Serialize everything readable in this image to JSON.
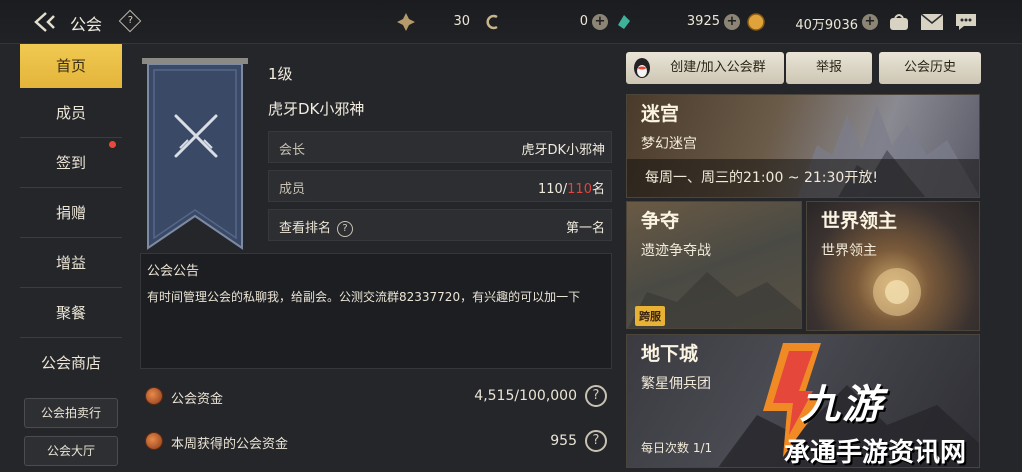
{
  "header": {
    "title": "公会",
    "help": "?",
    "resources": [
      {
        "value": "30"
      },
      {
        "value": "0"
      },
      {
        "value": "3925"
      },
      {
        "value": "40万9036"
      }
    ]
  },
  "sidebar": {
    "items": [
      {
        "label": "首页"
      },
      {
        "label": "成员"
      },
      {
        "label": "签到"
      },
      {
        "label": "捐赠"
      },
      {
        "label": "增益"
      },
      {
        "label": "聚餐"
      },
      {
        "label": "公会商店"
      }
    ],
    "bottom": [
      {
        "label": "公会拍卖行"
      },
      {
        "label": "公会大厅"
      }
    ]
  },
  "guild": {
    "level": "1级",
    "name": "虎牙DK小邪神",
    "leader_label": "会长",
    "leader_value": "虎牙DK小邪神",
    "members_label": "成员",
    "members_current": "110/",
    "members_max": "110",
    "members_unit": "名",
    "rank_label": "查看排名",
    "rank_value": "第一名"
  },
  "notice": {
    "title": "公会公告",
    "text": "有时间管理公会的私聊我，给副会。公测交流群82337720，有兴趣的可以加一下"
  },
  "funds": {
    "fund_label": "公会资金",
    "fund_value": "4,515/100,000",
    "weekly_label": "本周获得的公会资金",
    "weekly_value": "955"
  },
  "actions": {
    "join_group": "创建/加入公会群",
    "report": "举报",
    "history": "公会历史"
  },
  "panels": {
    "maze_title": "迷宫",
    "maze_sub": "梦幻迷宫",
    "maze_time": "每周一、周三的21:00 ~ 21:30开放!",
    "contest_title": "争夺",
    "contest_sub": "遗迹争夺战",
    "contest_tag": "跨服",
    "boss_title": "世界领主",
    "boss_sub": "世界领主",
    "dungeon_title": "地下城",
    "dungeon_sub": "繁星佣兵团",
    "dungeon_count": "每日次数 1/1"
  },
  "watermark": {
    "brand": "九游",
    "sub": "承通手游资讯网"
  }
}
